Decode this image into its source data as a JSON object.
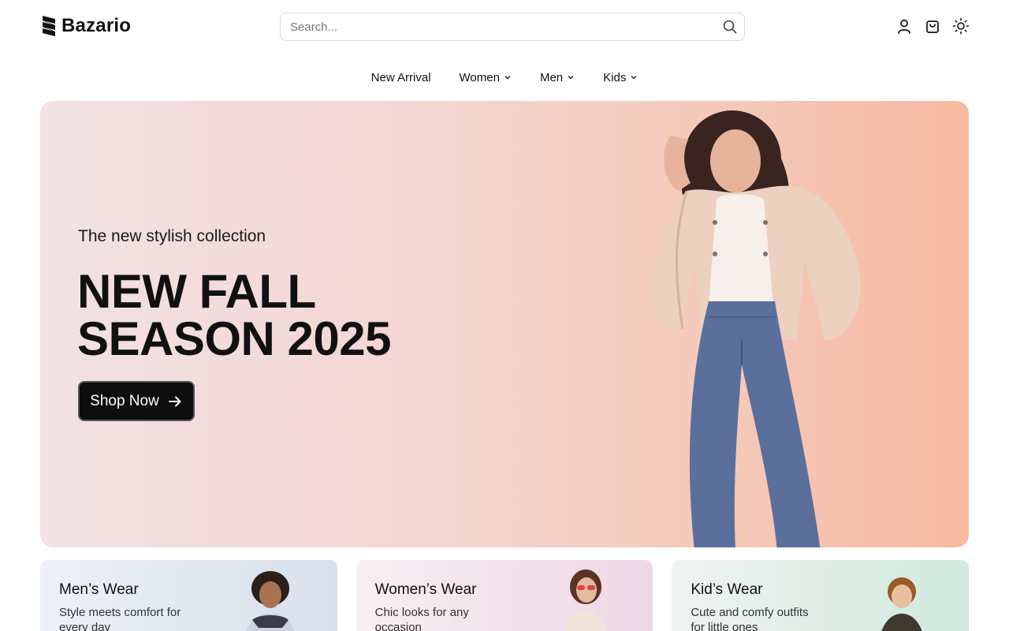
{
  "brand": {
    "name": "Bazario"
  },
  "search": {
    "placeholder": "Search..."
  },
  "header_icons": [
    "user-icon",
    "cart-icon",
    "sun-icon"
  ],
  "nav": {
    "items": [
      {
        "label": "New Arrival",
        "has_dropdown": false
      },
      {
        "label": "Women",
        "has_dropdown": true
      },
      {
        "label": "Men",
        "has_dropdown": true
      },
      {
        "label": "Kids",
        "has_dropdown": true
      }
    ]
  },
  "hero": {
    "subtitle": "The new stylish collection",
    "title_line1": "NEW FALL",
    "title_line2": "SEASON 2025",
    "cta_label": "Shop Now"
  },
  "categories": [
    {
      "title": "Men’s Wear",
      "desc": "Style meets comfort for every day"
    },
    {
      "title": "Women’s Wear",
      "desc": "Chic looks for any occasion"
    },
    {
      "title": "Kid’s Wear",
      "desc": "Cute and comfy outfits for little ones"
    }
  ],
  "colors": {
    "hero_gradient_start": "#f2e2e3",
    "hero_gradient_end": "#f6b9a0",
    "button_bg": "#0d0d0d",
    "text": "#111111"
  }
}
